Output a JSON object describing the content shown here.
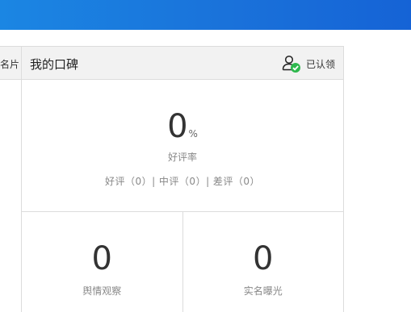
{
  "left_panel": {
    "title_fragment": "名片"
  },
  "reputation_card": {
    "title": "我的口碑",
    "claim_status": "已认领",
    "rating": {
      "value": "0",
      "unit": "%",
      "label": "好评率",
      "breakdown": "好评（0）| 中评（0）| 差评（0）"
    },
    "stats": [
      {
        "value": "0",
        "label": "舆情观察"
      },
      {
        "value": "0",
        "label": "实名曝光"
      }
    ]
  },
  "colors": {
    "top_bar": "#1a72da",
    "verified_badge": "#2db84d",
    "header_bg": "#f2f2f2",
    "border": "#dcdcdc"
  }
}
